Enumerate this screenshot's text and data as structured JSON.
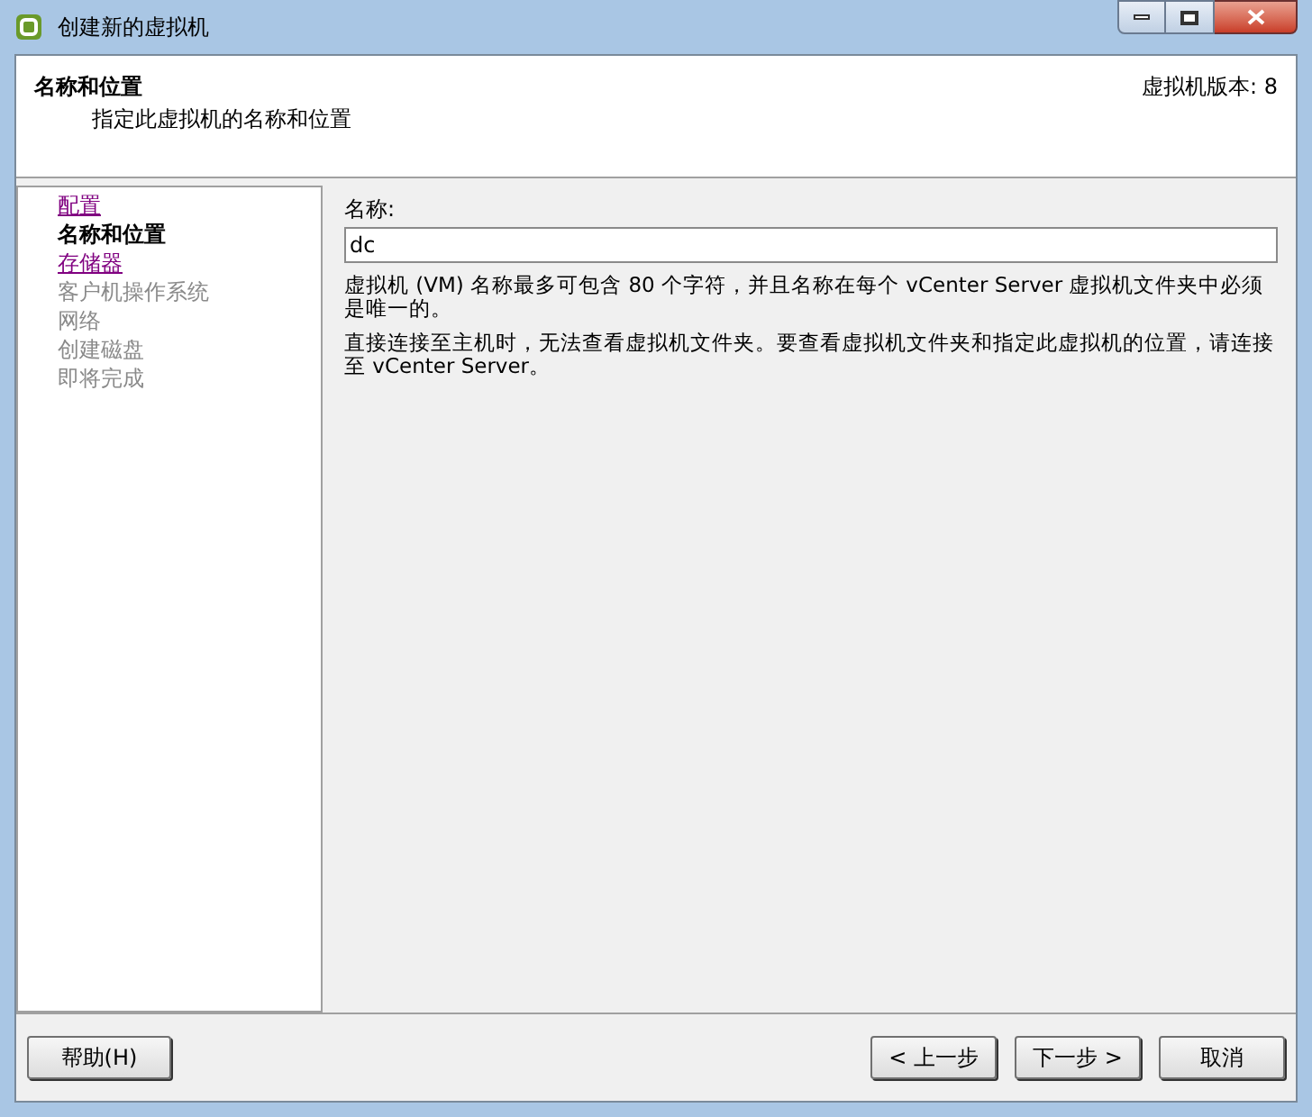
{
  "window": {
    "title": "创建新的虚拟机"
  },
  "header": {
    "title": "名称和位置",
    "subtitle": "指定此虚拟机的名称和位置",
    "version": "虚拟机版本: 8"
  },
  "steps": [
    {
      "label": "配置",
      "kind": "visited"
    },
    {
      "label": "名称和位置",
      "kind": "current"
    },
    {
      "label": "存储器",
      "kind": "visited"
    },
    {
      "label": "客户机操作系统",
      "kind": "pending"
    },
    {
      "label": "网络",
      "kind": "pending"
    },
    {
      "label": "创建磁盘",
      "kind": "pending"
    },
    {
      "label": "即将完成",
      "kind": "pending"
    }
  ],
  "form": {
    "label": "名称:",
    "value": "dc",
    "notes": [
      "虚拟机 (VM) 名称最多可包含 80 个字符，并且名称在每个 vCenter Server 虚拟机文件夹中必须是唯一的。",
      "直接连接至主机时，无法查看虚拟机文件夹。要查看虚拟机文件夹和指定此虚拟机的位置，请连接至 vCenter Server。"
    ]
  },
  "buttons": {
    "help": "帮助(H)",
    "back": "< 上一步",
    "next": "下一步 >",
    "cancel": "取消"
  }
}
